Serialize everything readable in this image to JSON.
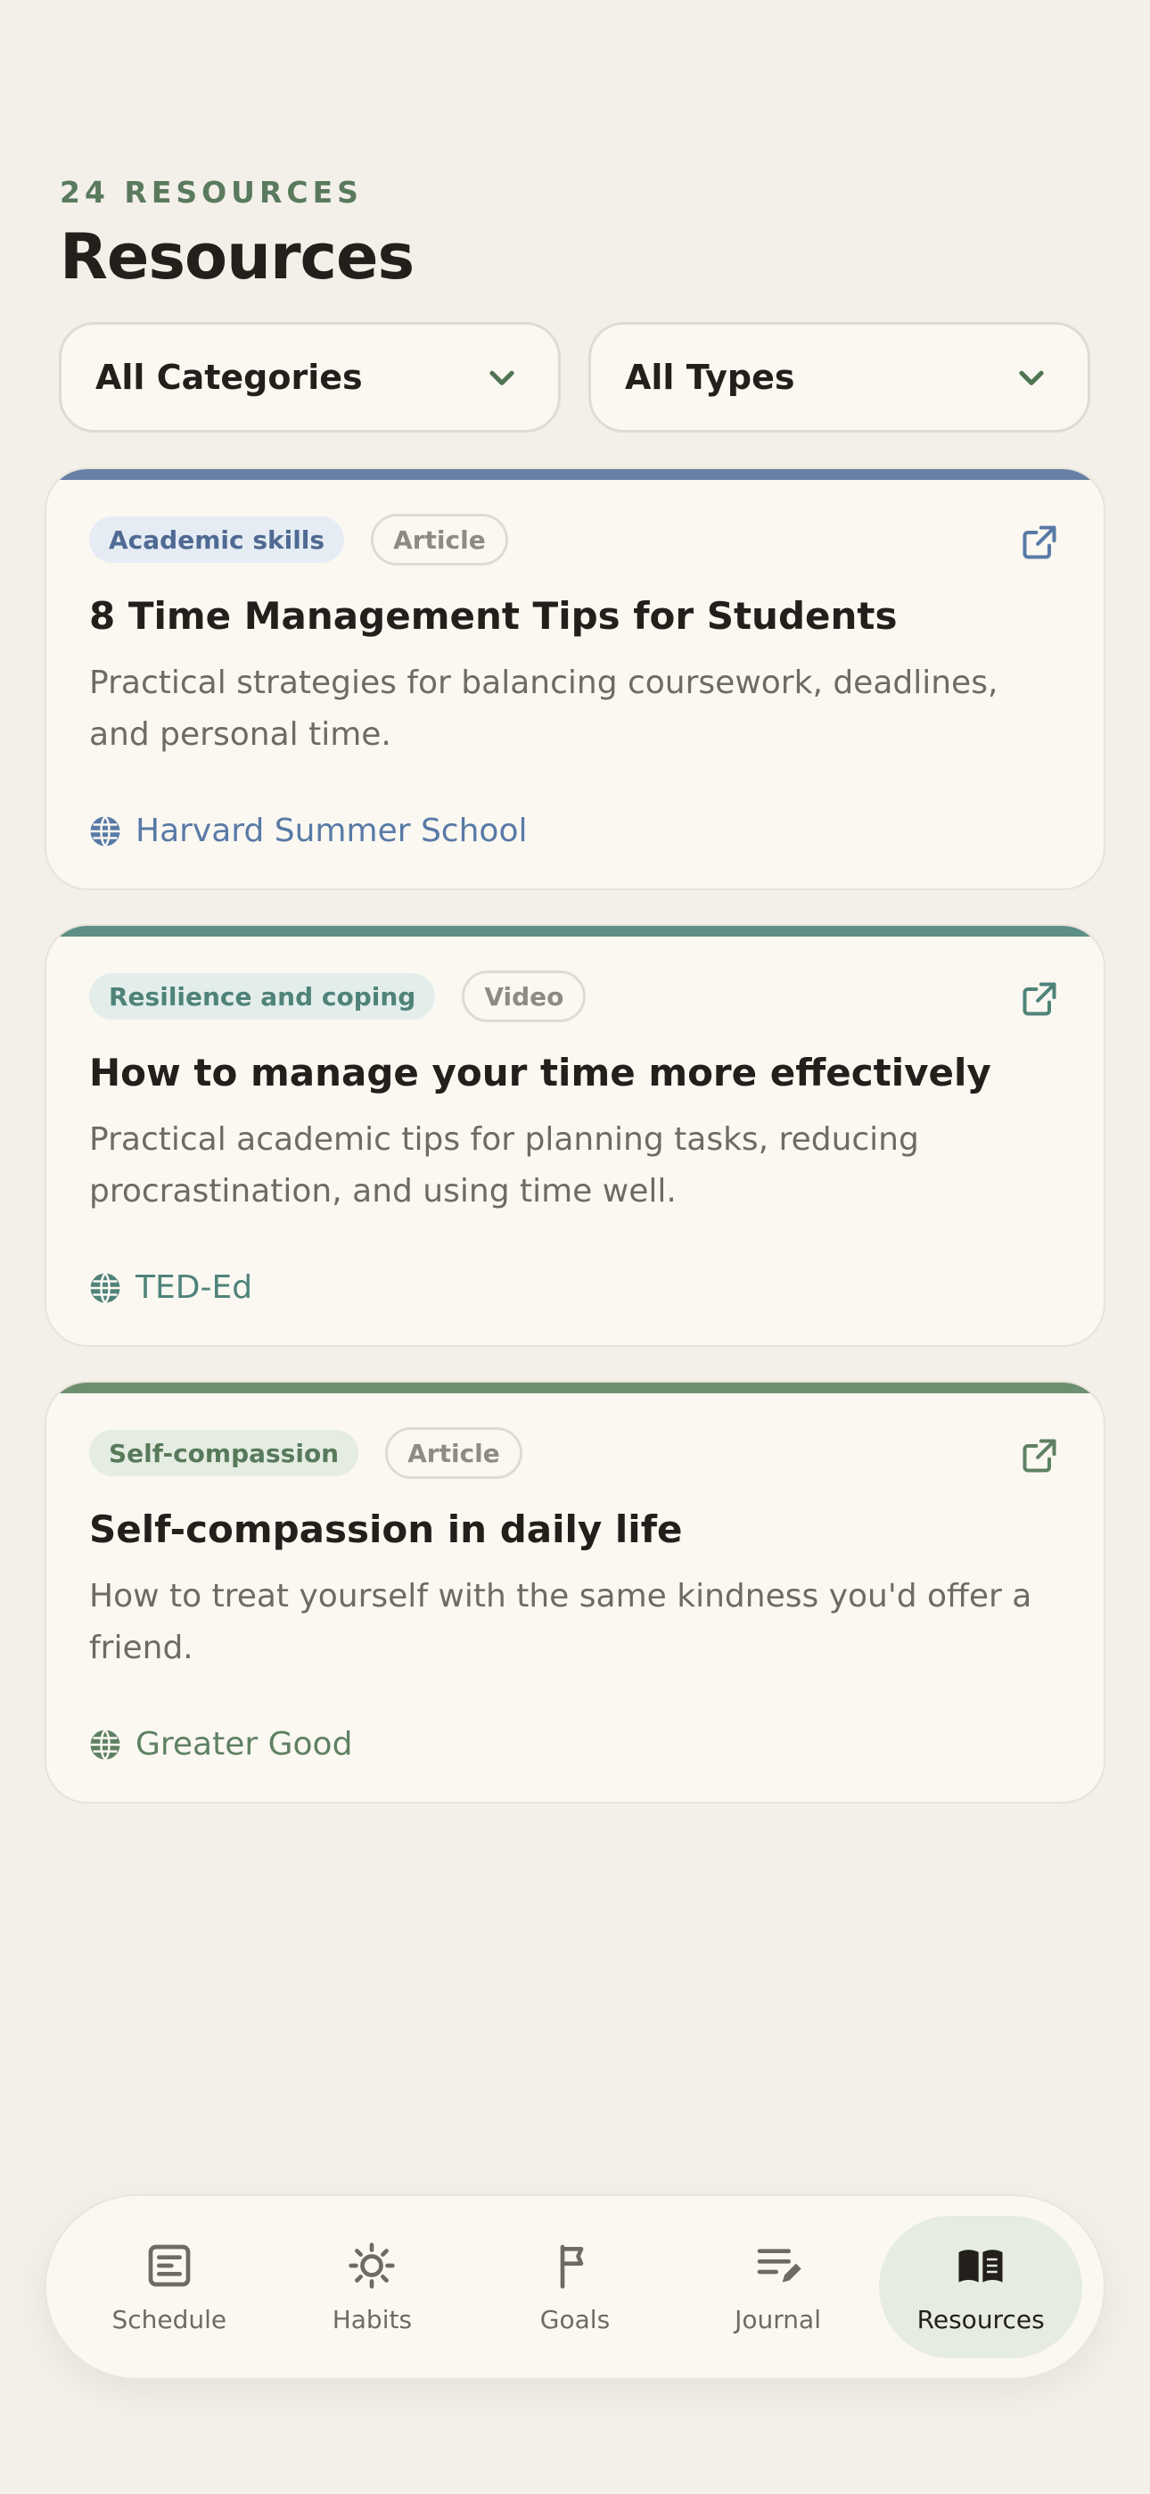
{
  "header": {
    "eyebrow": "24 RESOURCES",
    "title": "Resources"
  },
  "filters": {
    "category": "All Categories",
    "type": "All Types"
  },
  "cards": [
    {
      "category": "Academic skills",
      "type": "Article",
      "title": "8 Time Management Tips for Students",
      "description": "Practical strategies for balancing coursework, deadlines, and personal time.",
      "source": "Harvard Summer School",
      "accent": "#6680a6",
      "tag_bg": "#e6ecf4",
      "tag_fg": "#4f6a93",
      "source_color": "#587aa6"
    },
    {
      "category": "Resilience and coping",
      "type": "Video",
      "title": "How to manage your time more effectively",
      "description": "Practical academic tips for planning tasks, reducing procrastination, and using time well.",
      "source": "TED-Ed",
      "accent": "#5e8f86",
      "tag_bg": "#e3eeeb",
      "tag_fg": "#4f8379",
      "source_color": "#4f8379"
    },
    {
      "category": "Self-compassion",
      "type": "Article",
      "title": "Self-compassion in daily life",
      "description": "How to treat yourself with the same kindness you'd offer a friend.",
      "source": "Greater Good",
      "accent": "#6d8f6f",
      "tag_bg": "#e5ede3",
      "tag_fg": "#587a5b",
      "source_color": "#5f8163"
    }
  ],
  "nav": {
    "items": [
      {
        "label": "Schedule",
        "icon": "schedule-icon"
      },
      {
        "label": "Habits",
        "icon": "sun-icon"
      },
      {
        "label": "Goals",
        "icon": "flag-icon"
      },
      {
        "label": "Journal",
        "icon": "journal-icon"
      },
      {
        "label": "Resources",
        "icon": "book-icon"
      }
    ],
    "active": "Resources"
  }
}
